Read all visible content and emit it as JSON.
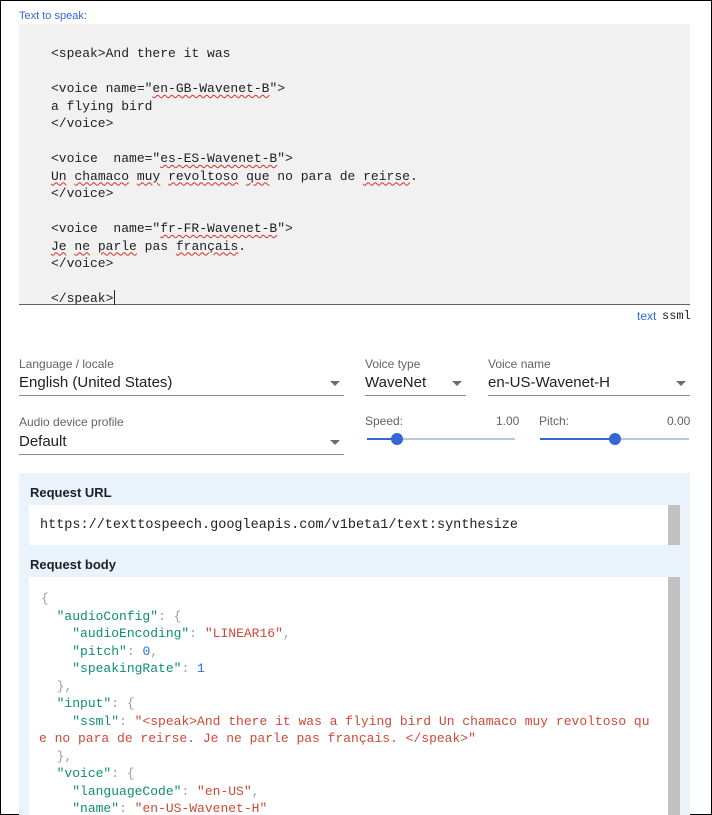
{
  "text_input": {
    "label": "Text to speak:",
    "lines": [
      {
        "parts": [
          {
            "t": "<speak>And there it was"
          }
        ]
      },
      {
        "parts": []
      },
      {
        "parts": [
          {
            "t": "<voice name=\""
          },
          {
            "t": "en-GB-Wavenet-B",
            "sq": true
          },
          {
            "t": "\">"
          }
        ]
      },
      {
        "parts": [
          {
            "t": "a flying bird"
          }
        ]
      },
      {
        "parts": [
          {
            "t": "</voice>"
          }
        ]
      },
      {
        "parts": []
      },
      {
        "parts": [
          {
            "t": "<voice  name=\""
          },
          {
            "t": "es-ES-Wavenet-B",
            "sq": true
          },
          {
            "t": "\">"
          }
        ]
      },
      {
        "parts": [
          {
            "t": "Un",
            "sq": true
          },
          {
            "t": " "
          },
          {
            "t": "chamaco",
            "sq": true
          },
          {
            "t": " "
          },
          {
            "t": "muy",
            "sq": true
          },
          {
            "t": " "
          },
          {
            "t": "revoltoso",
            "sq": true
          },
          {
            "t": " "
          },
          {
            "t": "que",
            "sq": true
          },
          {
            "t": " no para de "
          },
          {
            "t": "reirse",
            "sq": true
          },
          {
            "t": "."
          }
        ]
      },
      {
        "parts": [
          {
            "t": "</voice>"
          }
        ]
      },
      {
        "parts": []
      },
      {
        "parts": [
          {
            "t": "<voice  name=\""
          },
          {
            "t": "fr-FR-Wavenet-B",
            "sq": true
          },
          {
            "t": "\">"
          }
        ]
      },
      {
        "parts": [
          {
            "t": "Je",
            "sq": true
          },
          {
            "t": " "
          },
          {
            "t": "ne",
            "sq": true
          },
          {
            "t": " "
          },
          {
            "t": "parle",
            "sq": true
          },
          {
            "t": " pas "
          },
          {
            "t": "français",
            "sq": true
          },
          {
            "t": "."
          }
        ]
      },
      {
        "parts": [
          {
            "t": "</voice>"
          }
        ]
      },
      {
        "parts": []
      },
      {
        "parts": [
          {
            "t": "</speak>"
          }
        ],
        "caret": true
      }
    ]
  },
  "input_mode": {
    "text": "text",
    "ssml": "ssml",
    "selected": "ssml"
  },
  "language": {
    "label": "Language / locale",
    "value": "English (United States)"
  },
  "voice_type": {
    "label": "Voice type",
    "value": "WaveNet"
  },
  "voice_name": {
    "label": "Voice name",
    "value": "en-US-Wavenet-H"
  },
  "audio_profile": {
    "label": "Audio device profile",
    "value": "Default"
  },
  "speed": {
    "label": "Speed:",
    "value": "1.00",
    "level": 0.2
  },
  "pitch": {
    "label": "Pitch:",
    "value": "0.00",
    "level": 0.5
  },
  "request_url": {
    "title": "Request URL",
    "url": "https://texttospeech.googleapis.com/v1beta1/text:synthesize"
  },
  "request_body": {
    "title": "Request body",
    "lines": [
      [
        [
          "p",
          "{"
        ]
      ],
      [
        [
          "p",
          "  "
        ],
        [
          "k",
          "\"audioConfig\""
        ],
        [
          "p",
          ": {"
        ]
      ],
      [
        [
          "p",
          "    "
        ],
        [
          "k",
          "\"audioEncoding\""
        ],
        [
          "p",
          ": "
        ],
        [
          "s",
          "\"LINEAR16\""
        ],
        [
          "p",
          ","
        ]
      ],
      [
        [
          "p",
          "    "
        ],
        [
          "k",
          "\"pitch\""
        ],
        [
          "p",
          ": "
        ],
        [
          "n",
          "0"
        ],
        [
          "p",
          ","
        ]
      ],
      [
        [
          "p",
          "    "
        ],
        [
          "k",
          "\"speakingRate\""
        ],
        [
          "p",
          ": "
        ],
        [
          "n",
          "1"
        ]
      ],
      [
        [
          "p",
          "  },"
        ]
      ],
      [
        [
          "p",
          "  "
        ],
        [
          "k",
          "\"input\""
        ],
        [
          "p",
          ": {"
        ]
      ],
      [
        [
          "p",
          "    "
        ],
        [
          "k",
          "\"ssml\""
        ],
        [
          "p",
          ": "
        ],
        [
          "s",
          "\"<speak>And there it was a flying bird Un chamaco muy revoltoso qu"
        ]
      ],
      [
        [
          "s",
          "e no para de reirse. Je ne parle pas français. </speak>\""
        ]
      ],
      [
        [
          "p",
          "  },"
        ]
      ],
      [
        [
          "p",
          "  "
        ],
        [
          "k",
          "\"voice\""
        ],
        [
          "p",
          ": {"
        ]
      ],
      [
        [
          "p",
          "    "
        ],
        [
          "k",
          "\"languageCode\""
        ],
        [
          "p",
          ": "
        ],
        [
          "s",
          "\"en-US\""
        ],
        [
          "p",
          ","
        ]
      ],
      [
        [
          "p",
          "    "
        ],
        [
          "k",
          "\"name\""
        ],
        [
          "p",
          ": "
        ],
        [
          "s",
          "\"en-US-Wavenet-H\""
        ]
      ]
    ]
  },
  "colors": {
    "accent": "#3367d6",
    "panel": "#eaf3fb",
    "editor": "#f1f1f1",
    "key": "#0d8f6f",
    "string": "#d14836",
    "number": "#1a73e8"
  }
}
